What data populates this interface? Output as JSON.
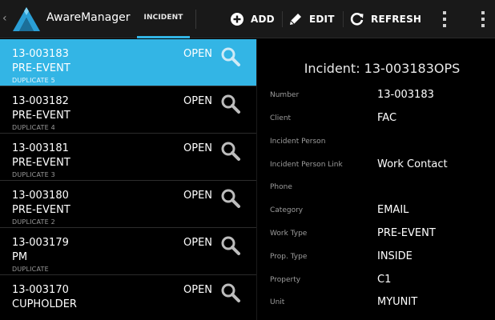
{
  "actionbar": {
    "app_title": "AwareManager",
    "active_tab": "INCIDENT",
    "buttons": [
      {
        "label": "ADD",
        "icon": "add-circle-icon"
      },
      {
        "label": "EDIT",
        "icon": "pencil-icon"
      },
      {
        "label": "REFRESH",
        "icon": "refresh-icon"
      }
    ],
    "overflow_icon": "overflow-menu-icon",
    "colors": {
      "background": "#191919",
      "accent": "#33b5e5"
    }
  },
  "incidents": [
    {
      "number": "13-003183",
      "event": "PRE-EVENT",
      "duplicate": "DUPLICATE 5",
      "status": "OPEN",
      "selected": true
    },
    {
      "number": "13-003182",
      "event": "PRE-EVENT",
      "duplicate": "DUPLICATE 4",
      "status": "OPEN",
      "selected": false
    },
    {
      "number": "13-003181",
      "event": "PRE-EVENT",
      "duplicate": "DUPLICATE 3",
      "status": "OPEN",
      "selected": false
    },
    {
      "number": "13-003180",
      "event": "PRE-EVENT",
      "duplicate": "DUPLICATE 2",
      "status": "OPEN",
      "selected": false
    },
    {
      "number": "13-003179",
      "event": "PM",
      "duplicate": "DUPLICATE",
      "status": "OPEN",
      "selected": false
    },
    {
      "number": "13-003170",
      "event": "CUPHOLDER",
      "duplicate": "",
      "status": "OPEN",
      "selected": false
    }
  ],
  "detail": {
    "title": "Incident: 13-003183OPS",
    "fields": [
      {
        "label": "Number",
        "value": "13-003183"
      },
      {
        "label": "Client",
        "value": "FAC"
      },
      {
        "label": "Incident Person",
        "value": ""
      },
      {
        "label": "Incident Person Link",
        "value": "Work Contact"
      },
      {
        "label": "Phone",
        "value": ""
      },
      {
        "label": "Category",
        "value": "EMAIL"
      },
      {
        "label": "Work Type",
        "value": "PRE-EVENT"
      },
      {
        "label": "Prop. Type",
        "value": "INSIDE"
      },
      {
        "label": "Property",
        "value": "C1"
      },
      {
        "label": "Unit",
        "value": "MYUNIT"
      }
    ]
  }
}
